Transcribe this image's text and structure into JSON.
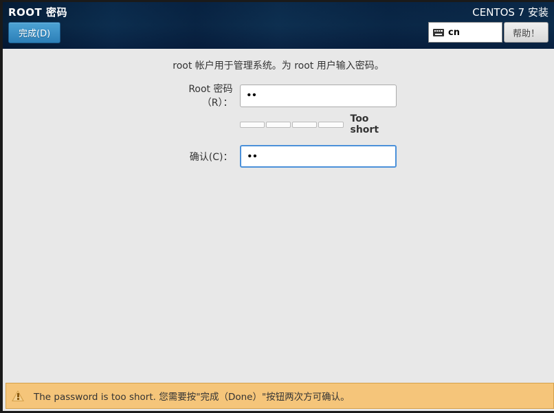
{
  "header": {
    "title": "ROOT 密码",
    "done_label": "完成(D)",
    "install_title": "CENTOS 7 安装",
    "lang_code": "cn",
    "help_label": "帮助！"
  },
  "form": {
    "description": "root 帐户用于管理系统。为 root 用户输入密码。",
    "password_label": "Root 密码（R）：",
    "password_value": "••",
    "confirm_label": "确认(C)：",
    "confirm_value": "••",
    "strength_text": "Too short"
  },
  "warning": {
    "message": "The password is too short. 您需要按\"完成（Done）\"按钮两次方可确认。"
  }
}
